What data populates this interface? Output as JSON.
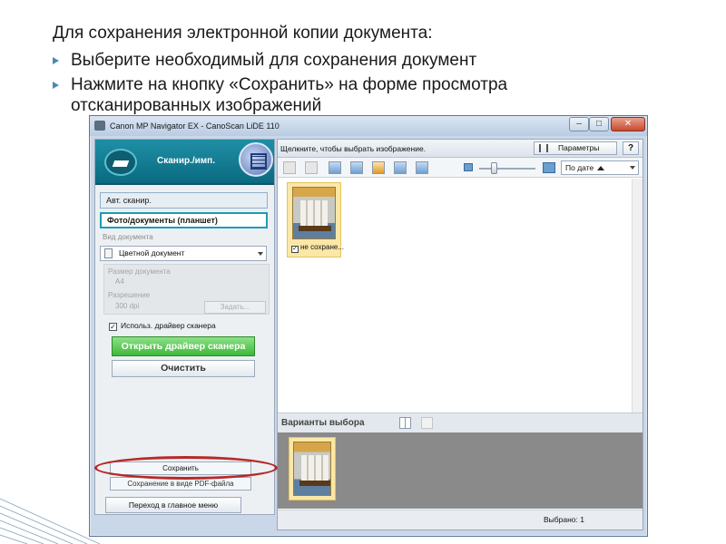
{
  "slide": {
    "heading": "Для сохранения электронной копии документа:",
    "bullets": [
      "Выберите необходимый для сохранения документ",
      "Нажмите на кнопку «Сохранить» на форме просмотра отсканированных изображений"
    ],
    "bullet_color": "#4a8ab0"
  },
  "window": {
    "title": "Canon MP Navigator EX - CanoScan LiDE 110",
    "buttons": {
      "minimize": "–",
      "maximize": "□",
      "close": "✕"
    }
  },
  "left_panel": {
    "mode_label": "Сканир./имп.",
    "modes": [
      "Авт. сканир.",
      "Фото/документы (планшет)"
    ],
    "doc_type_label": "Вид документа",
    "doc_type_value": "Цветной документ",
    "doc_size_label": "Размер документа",
    "doc_size_value": "A4",
    "resolution_label": "Разрешение",
    "resolution_value": "300 dpi",
    "set_button": "Задать...",
    "use_driver_checkbox": "Использ. драйвер сканера",
    "use_driver_checked": true,
    "open_driver_button": "Открыть драйвер сканера",
    "clear_button": "Очистить",
    "save_button": "Сохранить",
    "save_pdf_button": "Сохранение в виде PDF-файла",
    "main_menu_button": "Переход в главное меню"
  },
  "right_panel": {
    "hint": "Щелкните, чтобы выбрать изображение.",
    "params_button": "Параметры",
    "help_button": "?",
    "sort_value": "По дате",
    "thumbnail_caption": "не сохране...",
    "thumbnail_checked": true,
    "selection_header": "Варианты выбора",
    "status_selected": "Выбрано: 1"
  },
  "colors": {
    "accent_teal": "#1d9cb5",
    "open_driver_green": "#3eb839",
    "highlight_red": "#b52a2a"
  }
}
